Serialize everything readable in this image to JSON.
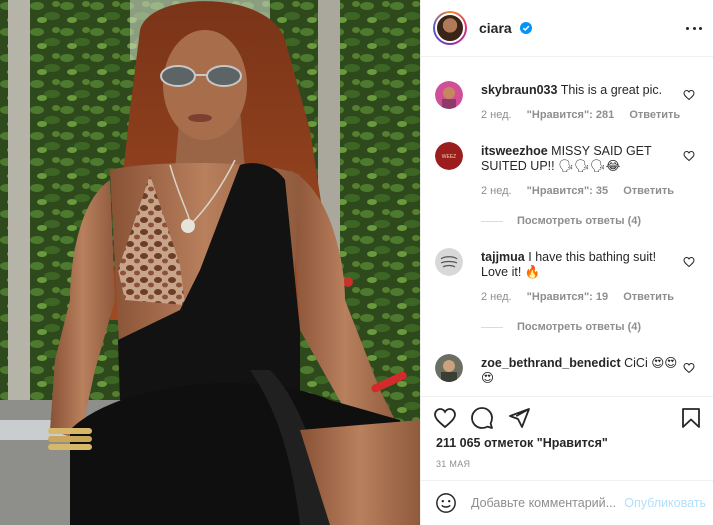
{
  "post": {
    "author": "ciara",
    "verified": true,
    "image_alt": "Photo of woman in sunglasses and black swimsuit",
    "likes_text": "211 065 отметок \"Нравится\"",
    "date_text": "31 МАЯ"
  },
  "comments": [
    {
      "user": "skybraun033",
      "text": "This is a great pic.",
      "age": "2 нед.",
      "likes": "\"Нравится\": 281",
      "reply": "Ответить"
    },
    {
      "user": "itsweezhoe",
      "text": "MISSY SAID GET SUITED UP!! 🗣🗣🗣😂",
      "age": "2 нед.",
      "likes": "\"Нравится\": 35",
      "reply": "Ответить",
      "view_replies": "Посмотреть ответы (4)",
      "avatar_text": "WEEZ"
    },
    {
      "user": "tajjmua",
      "text": "I have this bathing suit! Love it! 🔥",
      "age": "2 нед.",
      "likes": "\"Нравится\": 19",
      "reply": "Ответить",
      "view_replies": "Посмотреть ответы (4)"
    },
    {
      "user": "zoe_bethrand_benedict",
      "text": "CiCi 😍😍😍"
    }
  ],
  "add_comment": {
    "placeholder": "Добавьте комментарий...",
    "post_label": "Опубликовать"
  },
  "icons": {
    "more": "more-options-icon",
    "like": "heart-icon",
    "comment": "comment-bubble-icon",
    "share": "paper-plane-icon",
    "save": "bookmark-icon",
    "emoji": "emoji-icon",
    "verified": "verified-badge-icon"
  },
  "colors": {
    "verified": "#0095f6",
    "post_disabled": "#b2dffc",
    "muted": "#8e8e8e",
    "text": "#262626"
  }
}
